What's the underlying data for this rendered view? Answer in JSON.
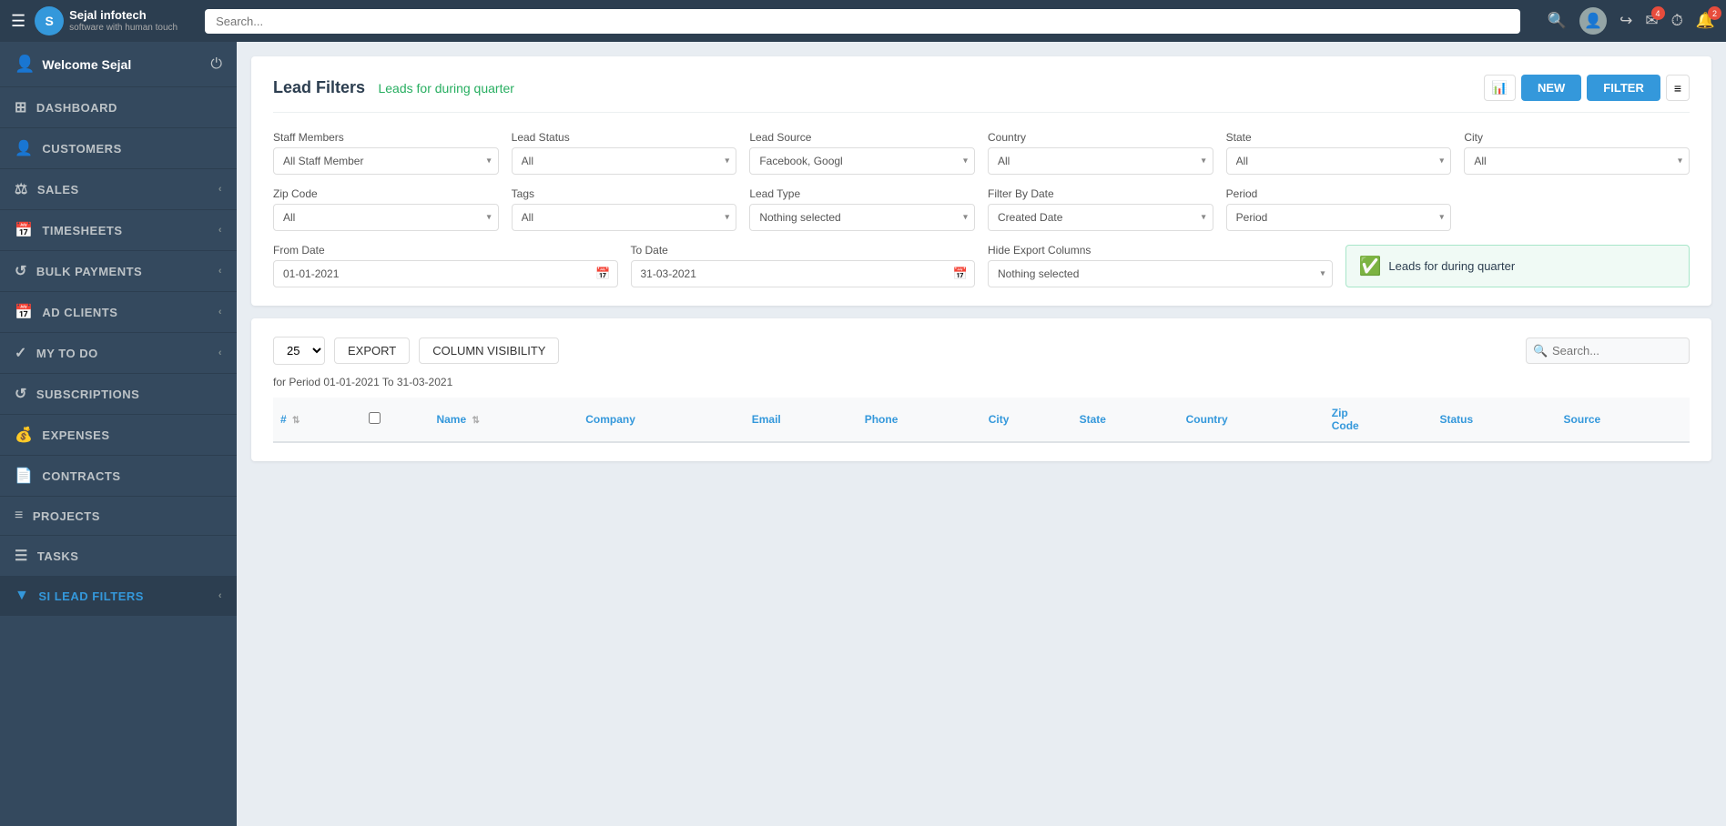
{
  "topnav": {
    "logo_letter": "S",
    "logo_name": "Sejal infotech",
    "logo_tagline": "software with human touch",
    "search_placeholder": "Search...",
    "badge_messages": "4",
    "badge_notifications": "2"
  },
  "sidebar": {
    "user_label": "Welcome Sejal",
    "items": [
      {
        "id": "dashboard",
        "label": "DASHBOARD",
        "icon": "⊞",
        "has_chevron": false
      },
      {
        "id": "customers",
        "label": "CUSTOMERS",
        "icon": "👤",
        "has_chevron": false
      },
      {
        "id": "sales",
        "label": "SALES",
        "icon": "⚖",
        "has_chevron": true
      },
      {
        "id": "timesheets",
        "label": "TIMESHEETS",
        "icon": "📅",
        "has_chevron": true
      },
      {
        "id": "bulk-payments",
        "label": "BULK PAYMENTS",
        "icon": "↺",
        "has_chevron": true
      },
      {
        "id": "ad-clients",
        "label": "AD CLIENTS",
        "icon": "📅",
        "has_chevron": true
      },
      {
        "id": "my-todo",
        "label": "MY TO DO",
        "icon": "✓",
        "has_chevron": true
      },
      {
        "id": "subscriptions",
        "label": "SUBSCRIPTIONS",
        "icon": "↺",
        "has_chevron": false
      },
      {
        "id": "expenses",
        "label": "EXPENSES",
        "icon": "💰",
        "has_chevron": false
      },
      {
        "id": "contracts",
        "label": "CONTRACTS",
        "icon": "📄",
        "has_chevron": false
      },
      {
        "id": "projects",
        "label": "PROJECTS",
        "icon": "≡",
        "has_chevron": false
      },
      {
        "id": "tasks",
        "label": "TASKS",
        "icon": "☰",
        "has_chevron": false
      },
      {
        "id": "si-lead-filters",
        "label": "SI LEAD FILTERS",
        "icon": "▼",
        "has_chevron": true
      }
    ]
  },
  "page": {
    "title": "Lead Filters",
    "subtitle": "Leads for during quarter",
    "btn_new": "NEW",
    "btn_filter": "FILTER"
  },
  "filters": {
    "staff_members_label": "Staff Members",
    "staff_members_value": "All Staff Member",
    "lead_status_label": "Lead Status",
    "lead_status_value": "All",
    "lead_source_label": "Lead Source",
    "lead_source_value": "Facebook, Googl",
    "country_label": "Country",
    "country_value": "All",
    "state_label": "State",
    "state_value": "All",
    "city_label": "City",
    "city_value": "All",
    "zip_code_label": "Zip Code",
    "zip_code_value": "All",
    "tags_label": "Tags",
    "tags_value": "All",
    "lead_type_label": "Lead Type",
    "lead_type_value": "Nothing selected",
    "filter_by_date_label": "Filter By Date",
    "filter_by_date_value": "Created Date",
    "period_label": "Period",
    "period_value": "Period",
    "from_date_label": "From Date",
    "from_date_value": "01-01-2021",
    "to_date_label": "To Date",
    "to_date_value": "31-03-2021",
    "hide_export_label": "Hide Export Columns",
    "hide_export_value": "Nothing selected",
    "success_text": "Leads for during quarter"
  },
  "table": {
    "rows_value": "25",
    "btn_export": "EXPORT",
    "btn_col_visibility": "COLUMN VISIBILITY",
    "search_placeholder": "Search...",
    "period_text": "for Period 01-01-2021 To 31-03-2021",
    "columns": [
      "#",
      "",
      "Name",
      "Company",
      "Email",
      "Phone",
      "City",
      "State",
      "Country",
      "Zip Code",
      "Status",
      "Source"
    ]
  }
}
